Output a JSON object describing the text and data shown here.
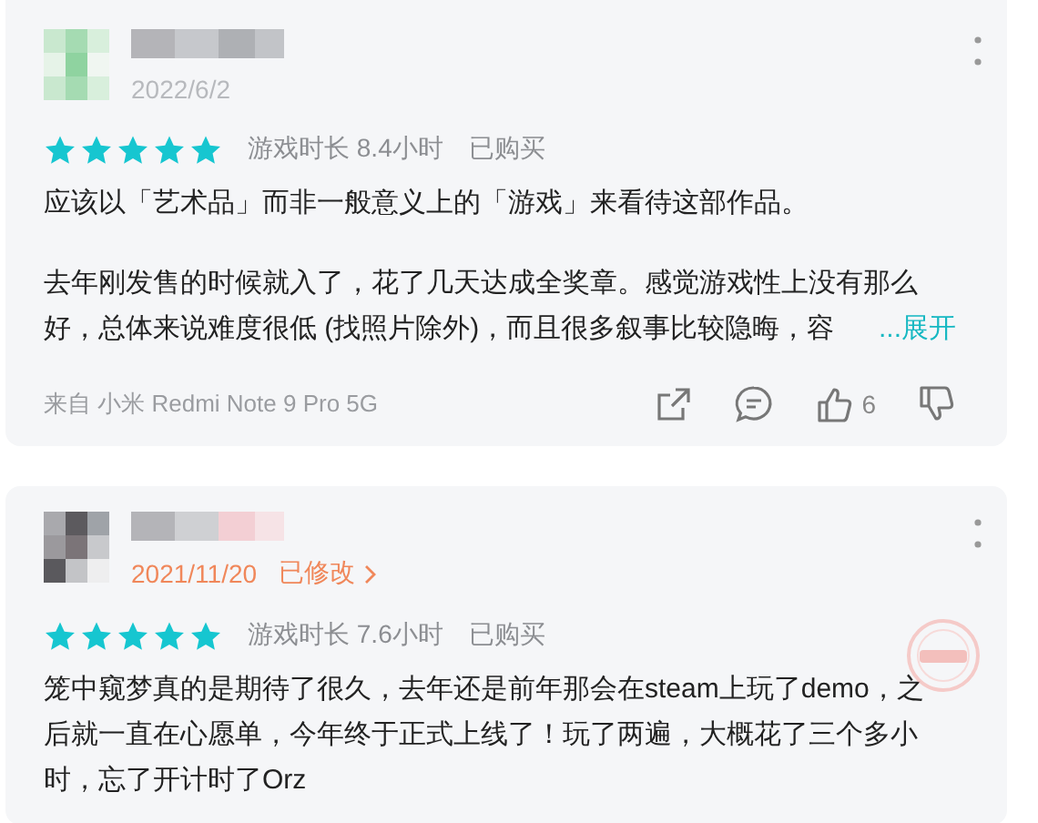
{
  "reviews": [
    {
      "date": "2022/6/2",
      "stars": 5,
      "playtime": "游戏时长 8.4小时",
      "purchased": "已购买",
      "paragraphs": [
        [
          "应该以「艺术品」而非一般意义上的「游戏」来看待这部作品。"
        ],
        [
          "去年刚发售的时候就入了，花了几天达成全奖章。感觉游戏性上没有那么",
          "好，总体来说难度很低 (找照片除外)，而且很多叙事比较隐晦，容"
        ]
      ],
      "expand": "...展开",
      "device": "来自 小米 Redmi Note 9 Pro 5G",
      "likes": "6",
      "stamp": false
    },
    {
      "date": "2021/11/20",
      "edited": "已修改",
      "stars": 5,
      "playtime": "游戏时长 7.6小时",
      "purchased": "已购买",
      "paragraphs": [
        [
          "笼中窥梦真的是期待了很久，去年还是前年那会在steam上玩了demo，之",
          "后就一直在心愿单，今年终于正式上线了！玩了两遍，大概花了三个多小",
          "时，忘了开计时了Orz"
        ]
      ],
      "stamp": true
    }
  ]
}
